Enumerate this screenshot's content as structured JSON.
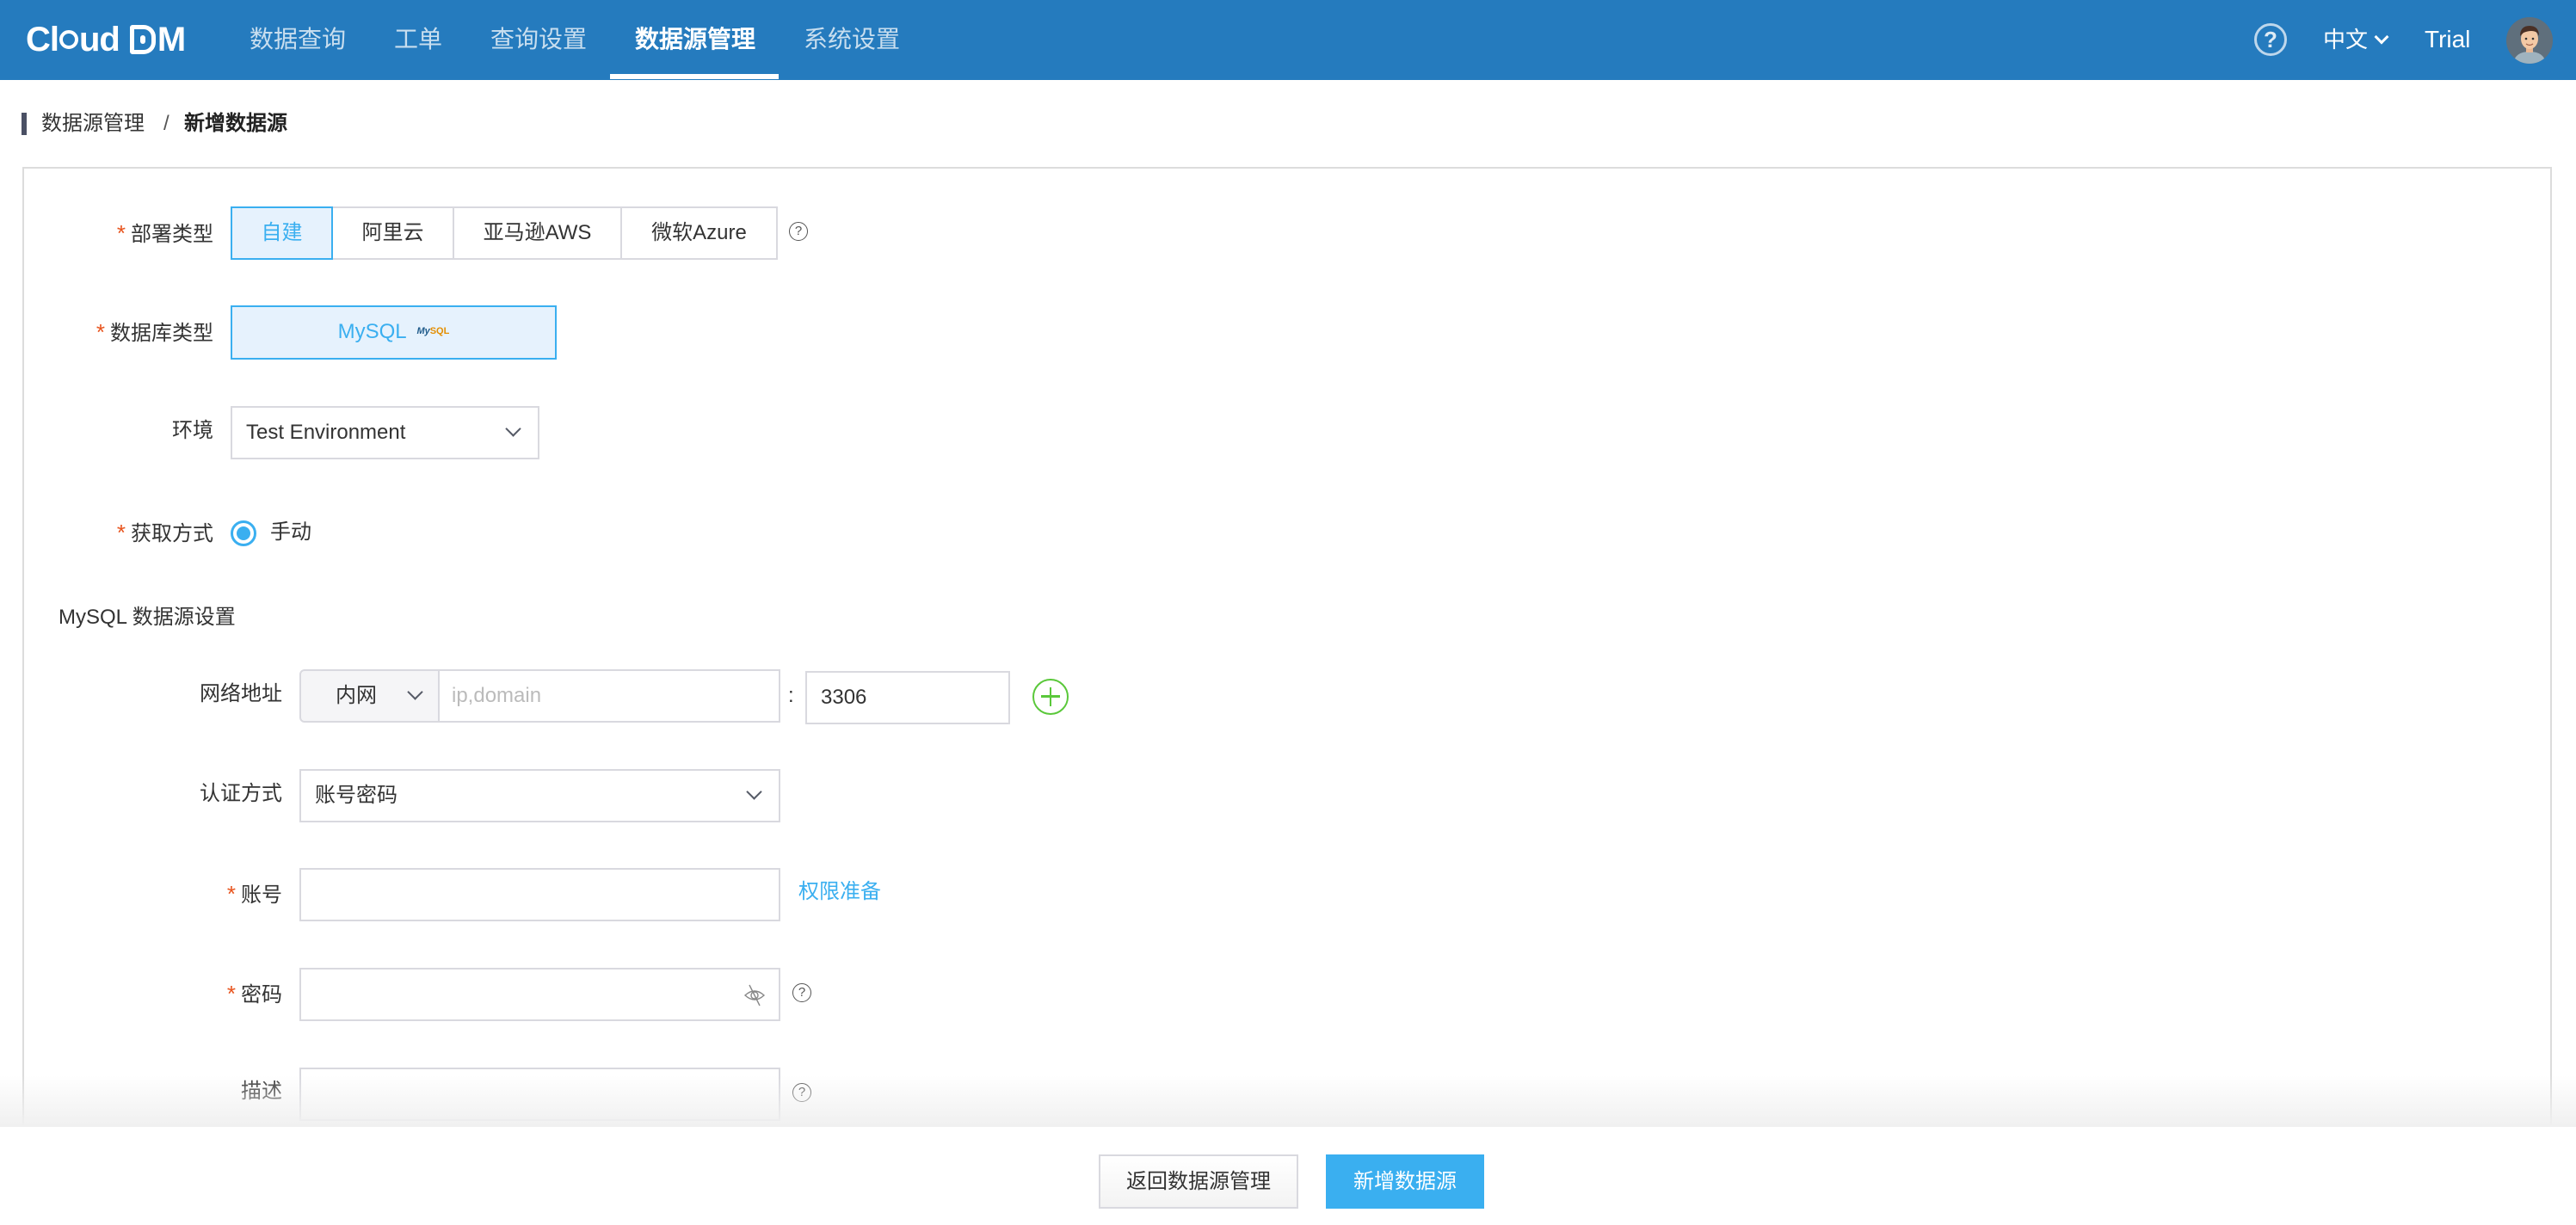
{
  "header": {
    "logo": "Cloud DM",
    "nav": [
      {
        "label": "数据查询",
        "active": false
      },
      {
        "label": "工单",
        "active": false
      },
      {
        "label": "查询设置",
        "active": false
      },
      {
        "label": "数据源管理",
        "active": true
      },
      {
        "label": "系统设置",
        "active": false
      }
    ],
    "help_icon": "question-circle-icon",
    "language": "中文",
    "user": "Trial"
  },
  "breadcrumb": {
    "parent": "数据源管理",
    "separator": "/",
    "current": "新增数据源"
  },
  "form": {
    "deploy_type": {
      "label": "部署类型",
      "required": true,
      "options": [
        "自建",
        "阿里云",
        "亚马逊AWS",
        "微软Azure"
      ],
      "selected": "自建"
    },
    "db_type": {
      "label": "数据库类型",
      "required": true,
      "value": "MySQL"
    },
    "environment": {
      "label": "环境",
      "value": "Test Environment"
    },
    "acquire_method": {
      "label": "获取方式",
      "required": true,
      "option": "手动",
      "checked": true
    },
    "section_title": "MySQL 数据源设置",
    "network": {
      "label": "网络地址",
      "type": "内网",
      "host_placeholder": "ip,domain",
      "host_value": "",
      "separator": ":",
      "port": "3306"
    },
    "auth": {
      "label": "认证方式",
      "value": "账号密码"
    },
    "account": {
      "label": "账号",
      "required": true,
      "value": "",
      "link": "权限准备"
    },
    "password": {
      "label": "密码",
      "required": true,
      "value": ""
    },
    "description": {
      "label": "描述",
      "value": ""
    }
  },
  "footer": {
    "back_label": "返回数据源管理",
    "submit_label": "新增数据源"
  },
  "colors": {
    "header_bg": "#257BBE",
    "accent": "#3AAFF0",
    "required": "#E8541E",
    "add": "#5AC83A"
  }
}
